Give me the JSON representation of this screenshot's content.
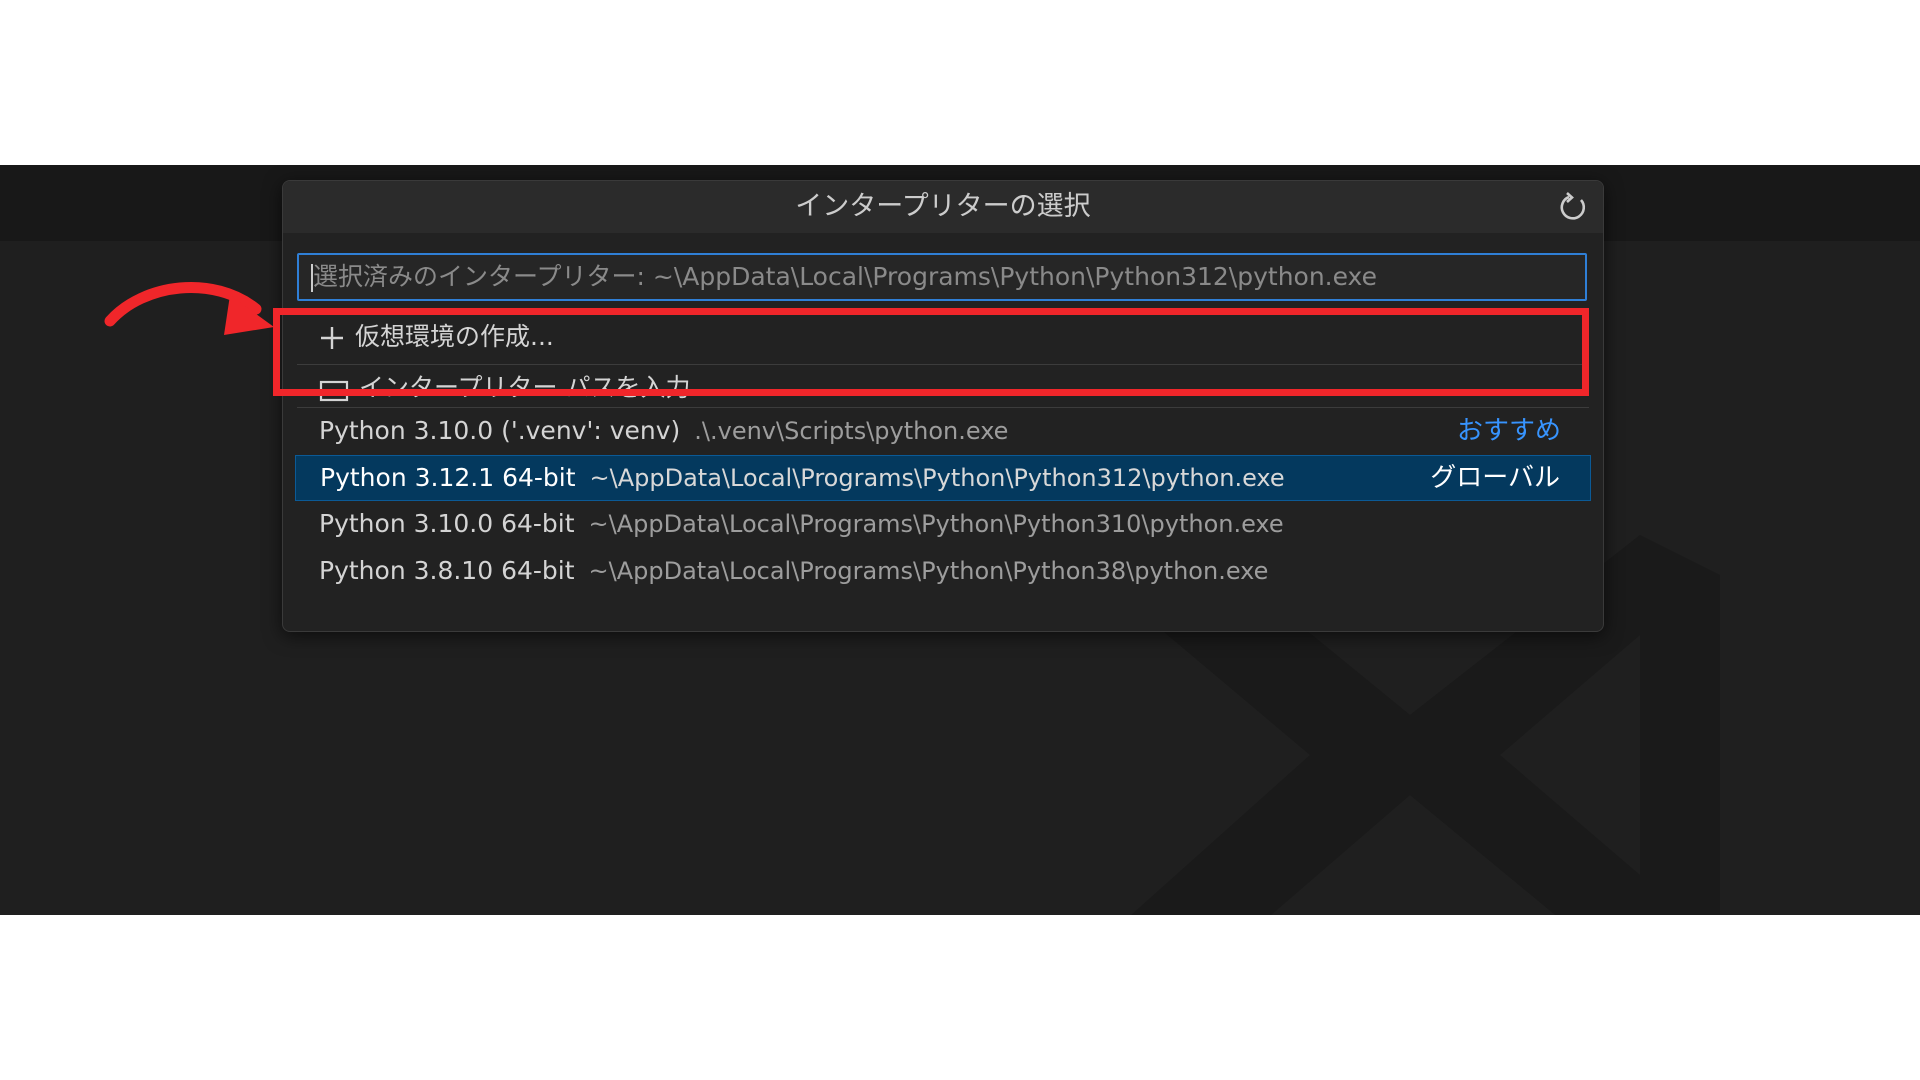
{
  "dialog": {
    "title": "インタープリターの選択",
    "refresh_icon": "refresh-icon",
    "input_placeholder": "選択済みのインタープリター: ~\\AppData\\Local\\Programs\\Python\\Python312\\python.exe"
  },
  "actions": [
    {
      "icon": "plus-icon",
      "label": "仮想環境の作成..."
    },
    {
      "icon": "folder-icon",
      "label": "インタープリター パスを入力..."
    }
  ],
  "interpreters": [
    {
      "label": "Python 3.10.0 ('.venv': venv)",
      "path": ".\\.venv\\Scripts\\python.exe",
      "tag": "おすすめ",
      "tag_color": "#3794ff",
      "selected": false
    },
    {
      "label": "Python 3.12.1 64-bit",
      "path": "~\\AppData\\Local\\Programs\\Python\\Python312\\python.exe",
      "tag": "グローバル",
      "selected": true
    },
    {
      "label": "Python 3.10.0 64-bit",
      "path": "~\\AppData\\Local\\Programs\\Python\\Python310\\python.exe",
      "tag": "",
      "selected": false
    },
    {
      "label": "Python 3.8.10 64-bit",
      "path": "~\\AppData\\Local\\Programs\\Python\\Python38\\python.exe",
      "tag": "",
      "selected": false
    }
  ],
  "colors": {
    "highlight": "#f0262a",
    "selection": "#04395e",
    "focus_border": "#2f7fd6",
    "editor_bg": "#1f1f1f"
  }
}
